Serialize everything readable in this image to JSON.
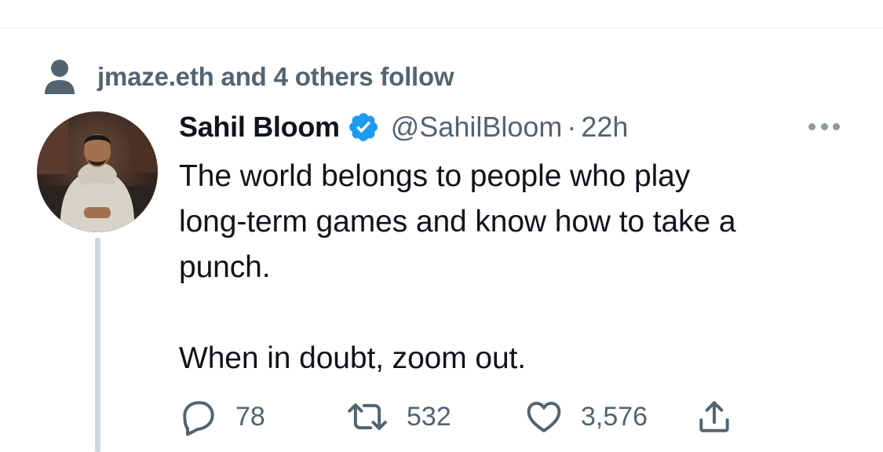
{
  "social_context": {
    "icon": "person-icon",
    "text": "jmaze.eth and 4 others follow"
  },
  "tweet": {
    "display_name": "Sahil Bloom",
    "verified": true,
    "handle": "@SahilBloom",
    "separator": "·",
    "time": "22h",
    "text": "The world belongs to people who play\nlong-term games and know how to take a\npunch.\n\nWhen in doubt, zoom out.",
    "reply_count": "78",
    "retweet_count": "532",
    "like_count": "3,576"
  },
  "colors": {
    "primary_text": "#0f1419",
    "secondary_text": "#536471",
    "verified_blue": "#1d9bf0",
    "thread_line": "#cfd9de",
    "divider": "#e6ecf0"
  },
  "icons": {
    "more": "more-icon",
    "reply": "reply-icon",
    "retweet": "retweet-icon",
    "like": "heart-icon",
    "share": "share-icon",
    "verified": "verified-badge-icon"
  }
}
